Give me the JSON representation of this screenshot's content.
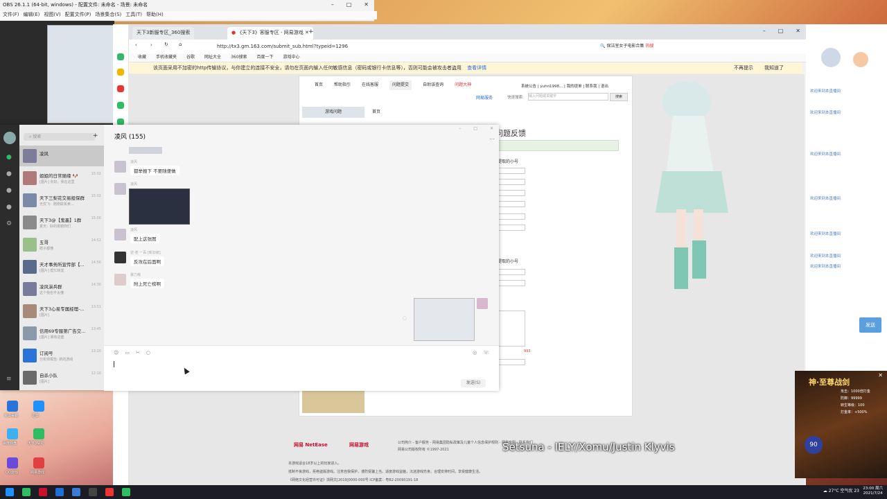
{
  "obs": {
    "title": "OBS 26.1.1 (64-bit, windows) - 配置文件: 未命名 - 场景: 未命名",
    "menu": [
      "文件(F)",
      "编辑(E)",
      "视图(V)",
      "配置文件(P)",
      "场景集合(S)",
      "工具(T)",
      "帮助(H)"
    ]
  },
  "browser": {
    "tabs": [
      {
        "label": "天下3新服专区_360搜索"
      },
      {
        "label": "《天下3》客服专区 - 网易游戏"
      }
    ],
    "url": "http://tx3.gm.163.com/submit_sub.html?typeid=1296",
    "search_box": "保洁室女子电影合集",
    "search_badge": "热搜",
    "bookmarks": [
      "收藏",
      "手机收藏夹",
      "谷歌",
      "网址大全",
      "360搜索",
      "百度一下",
      "游戏中心"
    ],
    "warning": "该页面采用不加密的http传输协议，与你建立的连接不安全，请勿在页面内输入任何敏感信息（密码或银行卡信息等），否则可能会被攻击者盗用",
    "warning_link": "查看详情",
    "warning_dismiss": "不再提示",
    "warning_ok": "我知道了"
  },
  "site": {
    "nav": [
      "首页",
      "帮助指引",
      "在线客服",
      "问题提交",
      "自助该查询",
      "问题大神"
    ],
    "user": "系统公告 | yuhn1998... | 我的提单 | 联系我 | 退出",
    "service_label": "网易服务",
    "search_label": "快速搜索:",
    "search_placeholder": "输入问题或关键字",
    "search_button": "搜索",
    "sidebar_item": "游戏问题",
    "breadcrumb": "首页",
    "page_title": "问题反馈",
    "field_label_1": "提取的小号",
    "field_label_2": "提取的小号",
    "counter": "933",
    "footer_links": "公司简介 - 客户服务 - 网易集团隐私政策及儿童个人信息保护规则 - 网易客服 - 联系我们",
    "footer_copy": "网易公司版权所有 ©1997-2021",
    "footer_notes": [
      "本游戏适合18岁以上的玩家进入。",
      "抵制不良游戏，拒绝盗版游戏。注意自我保护，谨防受骗上当。适度游戏益脑，沉迷游戏伤身。合理安排时间，享受健康生活。",
      "《网络文化经营许可证》浙网文[2019]0000-000号 ICP备案：粤B2-20090191-18"
    ],
    "brand_netease": "网易 NetEase",
    "brand_games": "网易游戏"
  },
  "qq": {
    "search_placeholder": "搜索",
    "conversation_title": "凌风 (155)",
    "contacts": [
      {
        "name": "凌风",
        "preview": "",
        "time": ""
      },
      {
        "name": "姐姐的日常随缘 🐶",
        "preview": "[图片] 你好，我在这里",
        "time": "15:02"
      },
      {
        "name": "天下三梨花交易担保群",
        "preview": "无忧飞：刚刚联系卖...",
        "time": "15:02"
      },
      {
        "name": "天下3@【鬼墨】1群",
        "preview": "夏天：好的谢谢你们",
        "time": "15:00"
      },
      {
        "name": "五哥",
        "preview": "瞎子都懂",
        "time": "14:52"
      },
      {
        "name": "天才事务所宣传部【...",
        "preview": "[图片] 帮忙转发",
        "time": "14:50"
      },
      {
        "name": "凌风演兵群",
        "preview": "这个我也不太懂",
        "time": "14:30"
      },
      {
        "name": "天下3心易专属经理-...",
        "preview": "[图片]",
        "time": "13:51"
      },
      {
        "name": "信用69专服第广告交...",
        "preview": "[图片] 谁有这套",
        "time": "13:45"
      },
      {
        "name": "订阅号",
        "preview": "分析师报告: 新的游戏",
        "time": "13:20"
      },
      {
        "name": "自杀小队",
        "preview": "[图片]",
        "time": "12:10"
      }
    ],
    "messages": [
      {
        "who": "凌风",
        "text": "都举报下 不要随便做"
      },
      {
        "who": "凌风",
        "text": ""
      },
      {
        "who": "凌风",
        "text": "配上这张图"
      },
      {
        "who": "逆·苍 一百 [新加坡]",
        "text": "反攻在后面啊"
      },
      {
        "who": "暴力萌",
        "text": "附上死亡榜啊"
      }
    ],
    "send_label": "发送(S)"
  },
  "stream": {
    "messages": [
      "欢迎来到本直播间",
      "欢迎来到本直播间",
      "欢迎来到本直播间",
      "欢迎来到本直播间",
      "欢迎来到本直播间",
      "欢迎来到本直播间",
      "欢迎来到本直播间"
    ],
    "send_label": "发送"
  },
  "ad": {
    "title": "神·至尊战剑",
    "stat_1": "攻击：1000倍打金",
    "stat_2": "防御：99999",
    "stat_3": "转生等级：100",
    "stat_4": "打金率：+500%",
    "level": "90"
  },
  "desktop_icons": [
    "金山毒霸",
    "迅雷",
    "百度网盘",
    "天下3梨花",
    "QQ游戏",
    "网易游戏"
  ],
  "overlay_song": "Setsuna - IELY/Xomu/Justin Klyvis",
  "taskbar": {
    "weather": "27°C 空气优 23",
    "time": "23:00 周六",
    "date": "2021/7/24"
  }
}
